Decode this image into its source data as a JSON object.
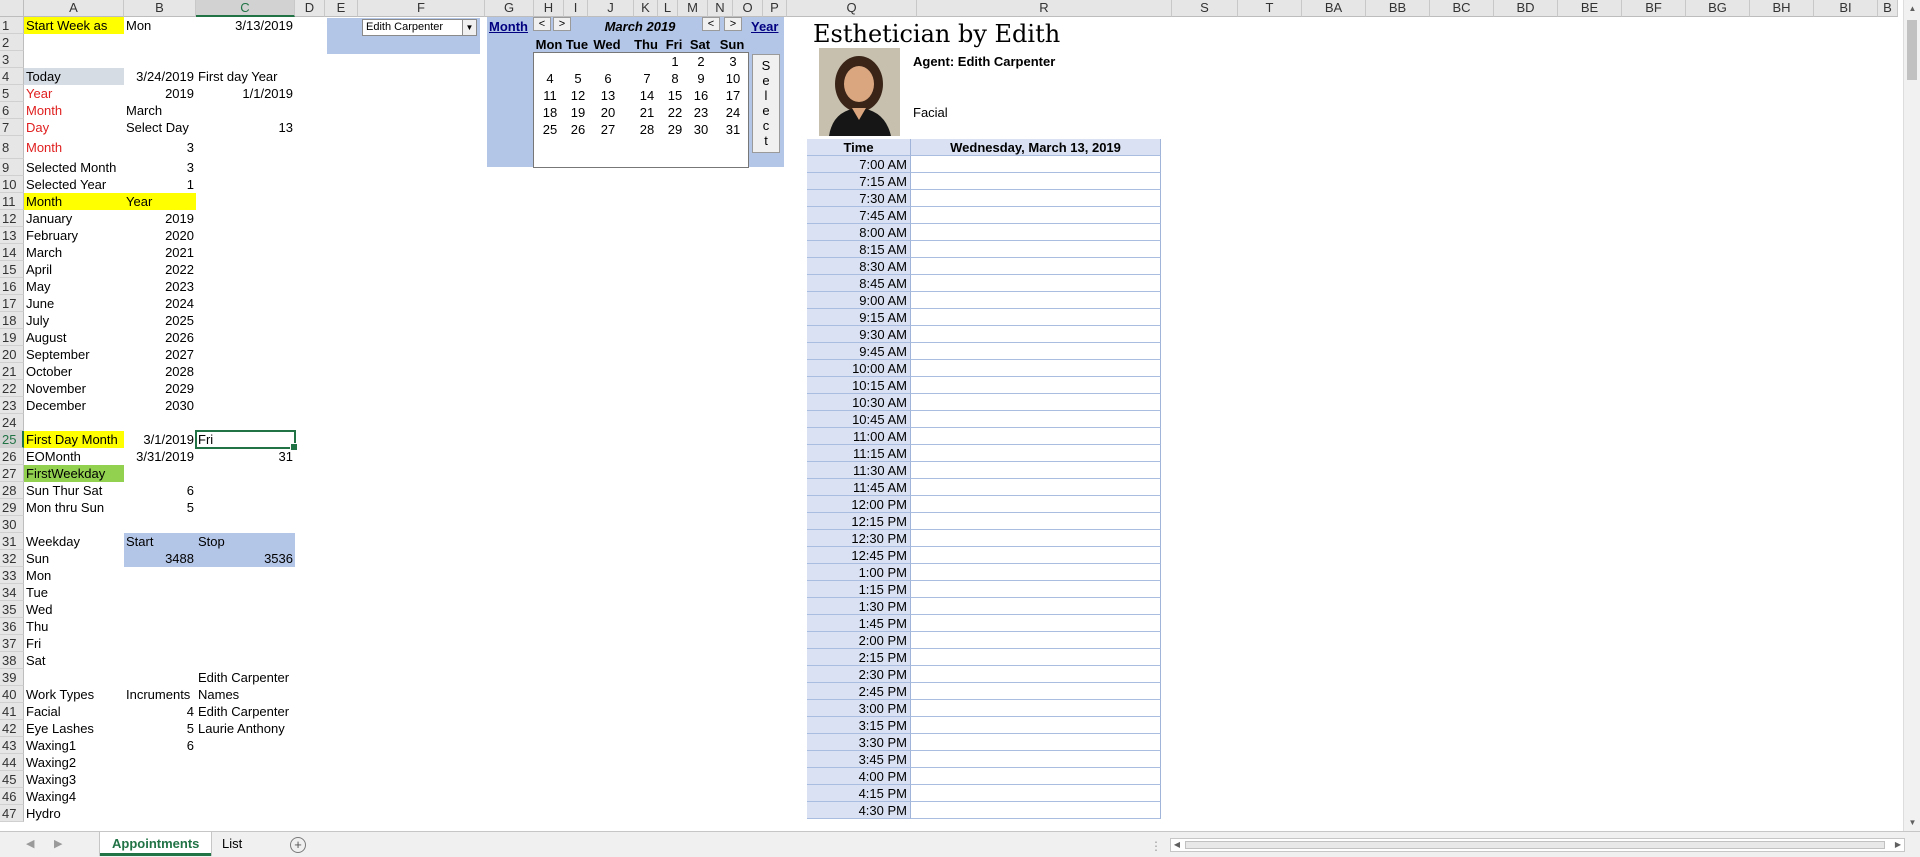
{
  "columns": [
    "A",
    "B",
    "C",
    "D",
    "E",
    "F",
    "G",
    "H",
    "I",
    "J",
    "K",
    "L",
    "M",
    "N",
    "O",
    "P",
    "Q",
    "R",
    "S",
    "T",
    "BA",
    "BB",
    "BC",
    "BD",
    "BE",
    "BF",
    "BG",
    "BH",
    "BI",
    "B"
  ],
  "rows": [
    "1",
    "2",
    "3",
    "4",
    "5",
    "6",
    "7",
    "8",
    "9",
    "10",
    "11",
    "12",
    "13",
    "14",
    "15",
    "16",
    "17",
    "18",
    "19",
    "20",
    "21",
    "22",
    "23",
    "24",
    "25",
    "26",
    "27",
    "28",
    "29",
    "30",
    "31",
    "32",
    "33",
    "34",
    "35",
    "36",
    "37",
    "38",
    "39",
    "40",
    "41",
    "42",
    "43",
    "44",
    "45",
    "46",
    "47"
  ],
  "cells": {
    "a1": "Start Week as",
    "b1": "Mon",
    "c1": "3/13/2019",
    "a4": "Today",
    "b4": "3/24/2019",
    "c4": "First day Year",
    "a5": "Year",
    "b5": "2019",
    "c5": "1/1/2019",
    "a6": "Month",
    "b6": "March",
    "a7": "Day",
    "b7": "Select Day",
    "c7": "13",
    "a8": "Month",
    "b8": "3",
    "a9": "Selected Month",
    "b9": "3",
    "a10": "Selected Year",
    "b10": "1",
    "a11": "Month",
    "b11": "Year",
    "a25": "First Day Month",
    "b25": "3/1/2019",
    "c25": "Fri",
    "a26": "EOMonth",
    "b26": "3/31/2019",
    "c26": "31",
    "a27": "FirstWeekday",
    "a28": "Sun Thur Sat",
    "b28": "6",
    "a29": "Mon thru Sun",
    "b29": "5",
    "a31": "Weekday",
    "b31": "Start",
    "c31": "Stop",
    "a32": "Sun",
    "b32": "3488",
    "c32": "3536",
    "c39": "Edith Carpenter",
    "a40": "Work Types",
    "b40": "Incruments",
    "c40": "Names",
    "a41": "Facial",
    "b41": "4",
    "c41": "Edith Carpenter",
    "a42": "Eye Lashes",
    "b42": "5",
    "c42": "Laurie Anthony",
    "a43": "Waxing1",
    "b43": "6",
    "a44": "Waxing2",
    "a45": "Waxing3",
    "a46": "Waxing4",
    "a47": "Hydro"
  },
  "month_year_list": [
    {
      "month": "January",
      "year": "2019"
    },
    {
      "month": "February",
      "year": "2020"
    },
    {
      "month": "March",
      "year": "2021"
    },
    {
      "month": "April",
      "year": "2022"
    },
    {
      "month": "May",
      "year": "2023"
    },
    {
      "month": "June",
      "year": "2024"
    },
    {
      "month": "July",
      "year": "2025"
    },
    {
      "month": "August",
      "year": "2026"
    },
    {
      "month": "September",
      "year": "2027"
    },
    {
      "month": "October",
      "year": "2028"
    },
    {
      "month": "November",
      "year": "2029"
    },
    {
      "month": "December",
      "year": "2030"
    }
  ],
  "weekdays_list": [
    "Mon",
    "Tue",
    "Wed",
    "Thu",
    "Fri",
    "Sat"
  ],
  "agent_dropdown": {
    "value": "Edith Carpenter"
  },
  "calendar": {
    "month_link": "Month",
    "year_link": "Year",
    "title": "March 2019",
    "prev": "<",
    "next": ">",
    "days_of_week": [
      "Mon",
      "Tue",
      "Wed",
      "Thu",
      "Fri",
      "Sat",
      "Sun"
    ],
    "weeks": [
      [
        "",
        "",
        "",
        "",
        "1",
        "2",
        "3"
      ],
      [
        "4",
        "5",
        "6",
        "7",
        "8",
        "9",
        "10"
      ],
      [
        "11",
        "12",
        "13",
        "14",
        "15",
        "16",
        "17"
      ],
      [
        "18",
        "19",
        "20",
        "21",
        "22",
        "23",
        "24"
      ],
      [
        "25",
        "26",
        "27",
        "28",
        "29",
        "30",
        "31"
      ]
    ],
    "select_button": "Select"
  },
  "header": {
    "title": "Esthetician by Edith",
    "agent_label": "Agent: Edith Carpenter",
    "service": "Facial"
  },
  "schedule": {
    "time_header": "Time",
    "date_header": "Wednesday, March 13, 2019",
    "times": [
      "7:00 AM",
      "7:15 AM",
      "7:30 AM",
      "7:45 AM",
      "8:00 AM",
      "8:15 AM",
      "8:30 AM",
      "8:45 AM",
      "9:00 AM",
      "9:15 AM",
      "9:30 AM",
      "9:45 AM",
      "10:00 AM",
      "10:15 AM",
      "10:30 AM",
      "10:45 AM",
      "11:00 AM",
      "11:15 AM",
      "11:30 AM",
      "11:45 AM",
      "12:00 PM",
      "12:15 PM",
      "12:30 PM",
      "12:45 PM",
      "1:00 PM",
      "1:15 PM",
      "1:30 PM",
      "1:45 PM",
      "2:00 PM",
      "2:15 PM",
      "2:30 PM",
      "2:45 PM",
      "3:00 PM",
      "3:15 PM",
      "3:30 PM",
      "3:45 PM",
      "4:00 PM",
      "4:15 PM",
      "4:30 PM"
    ]
  },
  "sheet_tabs": [
    {
      "label": "Appointments",
      "active": true
    },
    {
      "label": "List",
      "active": false
    }
  ],
  "add_sheet": "+",
  "colors": {
    "excel_green": "#217346",
    "highlight_yellow": "#ffff00",
    "highlight_green": "#92d050",
    "calendar_blue": "#b4c6e7",
    "time_blue": "#d9e1f2",
    "label_red": "#e02020"
  }
}
